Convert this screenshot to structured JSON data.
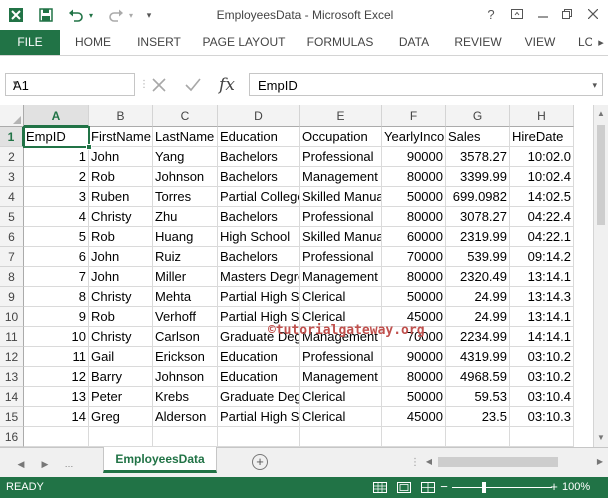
{
  "title_bar": {
    "title": "EmployeesData - Microsoft Excel",
    "icons": [
      "excel-icon",
      "save-icon",
      "undo-icon",
      "redo-icon",
      "customize-icon",
      "help-icon",
      "ribbon-display-icon",
      "minimize-icon",
      "restore-icon",
      "close-icon"
    ]
  },
  "ribbon": {
    "tabs": [
      "FILE",
      "HOME",
      "INSERT",
      "PAGE LAYOUT",
      "FORMULAS",
      "DATA",
      "REVIEW",
      "VIEW",
      "LO"
    ]
  },
  "formula_bar": {
    "name_box": "A1",
    "formula": "EmpID",
    "fx_label": "fx"
  },
  "grid": {
    "columns": [
      "A",
      "B",
      "C",
      "D",
      "E",
      "F",
      "G",
      "H"
    ],
    "row_numbers": [
      "1",
      "2",
      "3",
      "4",
      "5",
      "6",
      "7",
      "8",
      "9",
      "10",
      "11",
      "12",
      "13",
      "14",
      "15",
      "16"
    ],
    "rows": [
      [
        "EmpID",
        "FirstName",
        "LastName",
        "Education",
        "Occupation",
        "YearlyIncome",
        "Sales",
        "HireDate"
      ],
      [
        "1",
        "John",
        "Yang",
        "Bachelors",
        "Professional",
        "90000",
        "3578.27",
        "10:02.0"
      ],
      [
        "2",
        "Rob",
        "Johnson",
        "Bachelors",
        "Management",
        "80000",
        "3399.99",
        "10:02.4"
      ],
      [
        "3",
        "Ruben",
        "Torres",
        "Partial College",
        "Skilled Manual",
        "50000",
        "699.0982",
        "14:02.5"
      ],
      [
        "4",
        "Christy",
        "Zhu",
        "Bachelors",
        "Professional",
        "80000",
        "3078.27",
        "04:22.4"
      ],
      [
        "5",
        "Rob",
        "Huang",
        "High School",
        "Skilled Manual",
        "60000",
        "2319.99",
        "04:22.1"
      ],
      [
        "6",
        "John",
        "Ruiz",
        "Bachelors",
        "Professional",
        "70000",
        "539.99",
        "09:14.2"
      ],
      [
        "7",
        "John",
        "Miller",
        "Masters Degree",
        "Management",
        "80000",
        "2320.49",
        "13:14.1"
      ],
      [
        "8",
        "Christy",
        "Mehta",
        "Partial High School",
        "Clerical",
        "50000",
        "24.99",
        "13:14.3"
      ],
      [
        "9",
        "Rob",
        "Verhoff",
        "Partial High School",
        "Clerical",
        "45000",
        "24.99",
        "13:14.1"
      ],
      [
        "10",
        "Christy",
        "Carlson",
        "Graduate Degree",
        "Management",
        "70000",
        "2234.99",
        "14:14.1"
      ],
      [
        "11",
        "Gail",
        "Erickson",
        "Education",
        "Professional",
        "90000",
        "4319.99",
        "03:10.2"
      ],
      [
        "12",
        "Barry",
        "Johnson",
        "Education",
        "Management",
        "80000",
        "4968.59",
        "03:10.2"
      ],
      [
        "13",
        "Peter",
        "Krebs",
        "Graduate Degree",
        "Clerical",
        "50000",
        "59.53",
        "03:10.4"
      ],
      [
        "14",
        "Greg",
        "Alderson",
        "Partial High School",
        "Clerical",
        "45000",
        "23.5",
        "03:10.3"
      ],
      [
        "",
        "",
        "",
        "",
        "",
        "",
        "",
        ""
      ]
    ],
    "active_cell": "A1"
  },
  "watermark": "©tutorialgateway.org",
  "sheet_tabs": {
    "active": "EmployeesData",
    "add_icon": "+"
  },
  "status_bar": {
    "status": "READY",
    "zoom": "100%",
    "zoom_minus": "−",
    "zoom_plus": "+"
  },
  "colors": {
    "excel_green": "#217346",
    "watermark": "#c0504d"
  }
}
